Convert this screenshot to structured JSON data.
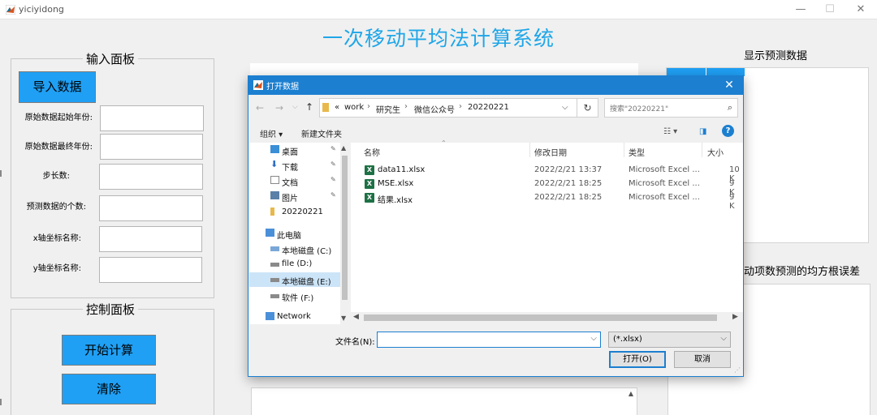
{
  "window": {
    "title": "yiciyidong",
    "minimize": "—",
    "maximize": "☐",
    "close": "✕"
  },
  "main_title": "一次移动平均法计算系统",
  "input_panel": {
    "title": "输入面板",
    "import_button": "导入数据",
    "fields": [
      {
        "label": "原始数据起始年份:",
        "value": ""
      },
      {
        "label": "原始数据最终年份:",
        "value": ""
      },
      {
        "label": "步长数:",
        "value": ""
      },
      {
        "label": "预测数据的个数:",
        "value": ""
      },
      {
        "label": "x轴坐标名称:",
        "value": ""
      },
      {
        "label": "y轴坐标名称:",
        "value": ""
      }
    ]
  },
  "control_panel": {
    "title": "控制面板",
    "start_button": "开始计算",
    "clear_button": "清除"
  },
  "right_panel": {
    "display_label": "显示预测数据",
    "rmse_label": "动项数预测的均方根误差"
  },
  "dialog": {
    "title": "打开数据",
    "close": "✕",
    "breadcrumb": [
      "«",
      "work",
      "研究生",
      "微信公众号",
      "20220221"
    ],
    "search_placeholder": "搜索\"20220221\"",
    "toolbar": {
      "organize": "组织 ▾",
      "new_folder": "新建文件夹"
    },
    "nav_items": [
      {
        "label": "桌面",
        "icon": "desktop-icon",
        "pinned": true
      },
      {
        "label": "下载",
        "icon": "download-icon",
        "pinned": true
      },
      {
        "label": "文档",
        "icon": "document-icon",
        "pinned": true
      },
      {
        "label": "图片",
        "icon": "picture-icon",
        "pinned": true
      },
      {
        "label": "20220221",
        "icon": "folder-icon",
        "pinned": false
      },
      {
        "label": "此电脑",
        "icon": "computer-icon",
        "pinned": false
      },
      {
        "label": "本地磁盘 (C:)",
        "icon": "drive-icon",
        "pinned": false
      },
      {
        "label": "file (D:)",
        "icon": "drive-icon",
        "pinned": false
      },
      {
        "label": "本地磁盘 (E:)",
        "icon": "drive-icon",
        "pinned": false,
        "selected": true
      },
      {
        "label": "软件 (F:)",
        "icon": "drive-icon",
        "pinned": false
      },
      {
        "label": "Network",
        "icon": "network-icon",
        "pinned": false
      }
    ],
    "columns": [
      "名称",
      "修改日期",
      "类型",
      "大小"
    ],
    "files": [
      {
        "name": "data11.xlsx",
        "date": "2022/2/21 13:37",
        "type": "Microsoft Excel ...",
        "size": "10 K"
      },
      {
        "name": "MSE.xlsx",
        "date": "2022/2/21 18:25",
        "type": "Microsoft Excel ...",
        "size": "9 K"
      },
      {
        "name": "结果.xlsx",
        "date": "2022/2/21 18:25",
        "type": "Microsoft Excel ...",
        "size": "9 K"
      }
    ],
    "filename_label": "文件名(N):",
    "filename_value": "",
    "filetype_value": "(*.xlsx)",
    "open_button": "打开(O)",
    "cancel_button": "取消"
  },
  "colors": {
    "accent_blue": "#1fa0f5",
    "title_blue": "#1fa6e8",
    "dialog_blue": "#1c7fd0"
  }
}
